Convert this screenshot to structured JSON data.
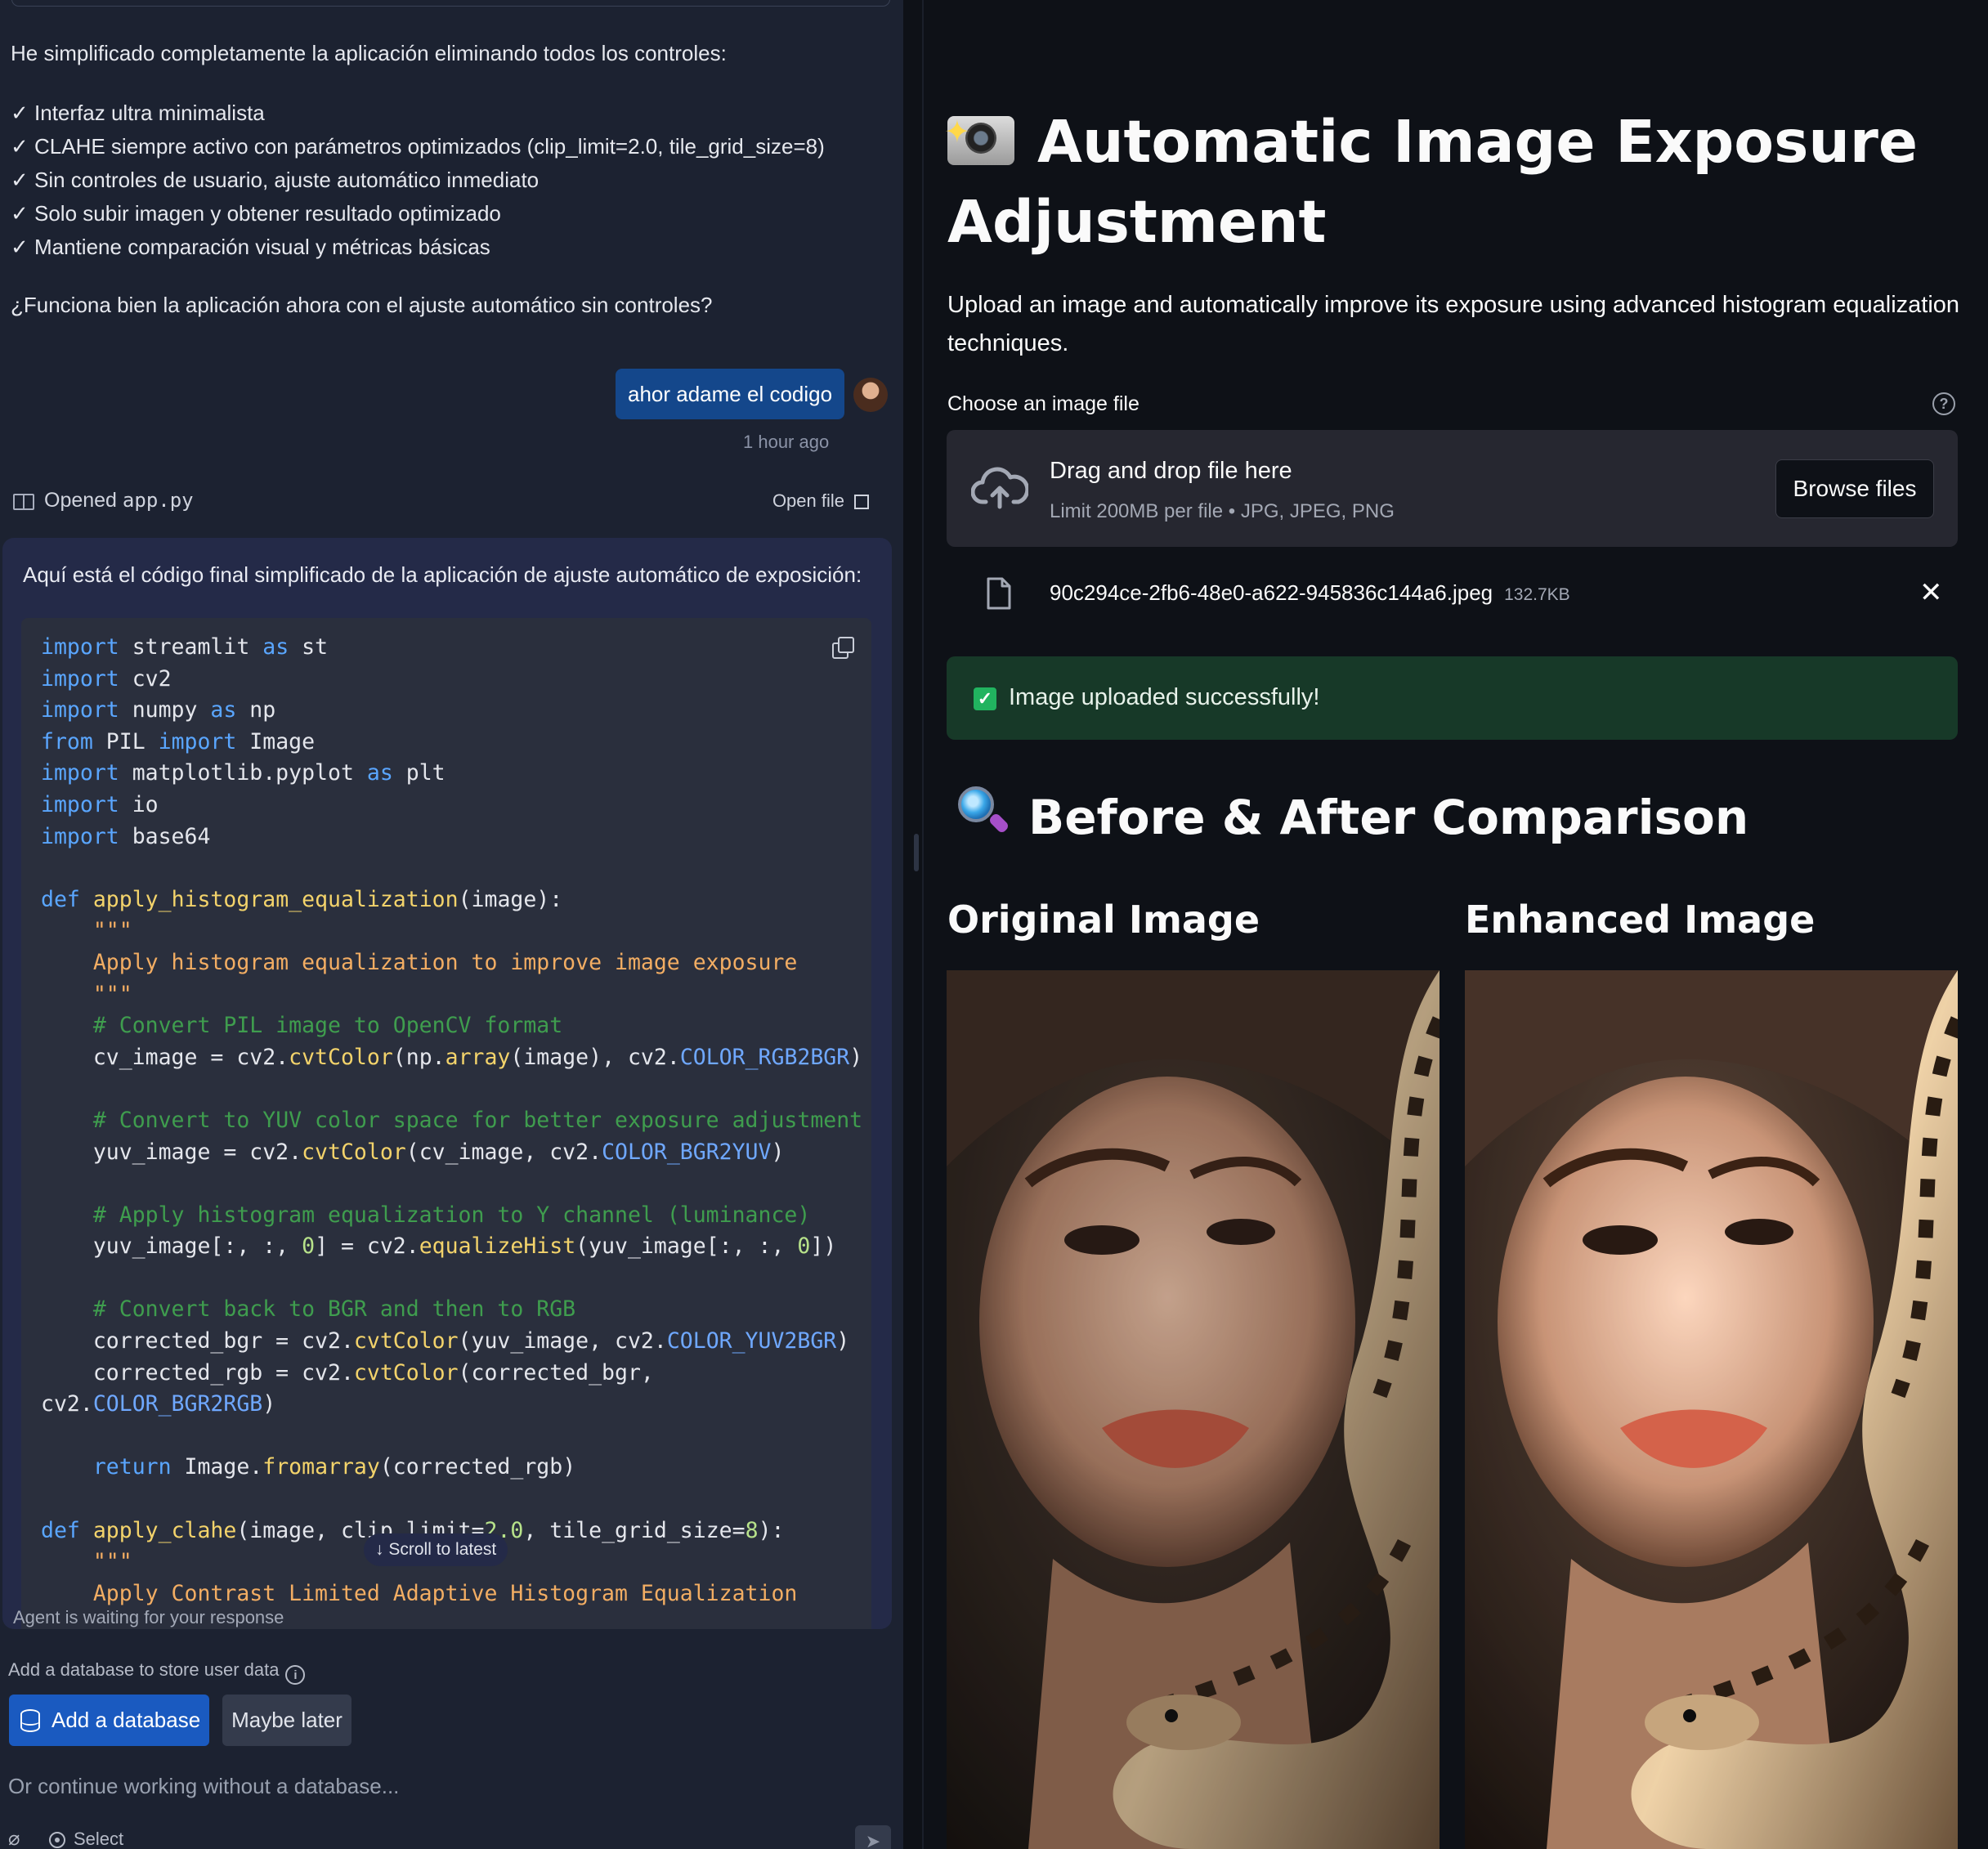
{
  "chat": {
    "intro": "He simplificado completamente la aplicación eliminando todos los controles:",
    "checklist": [
      "✓ Interfaz ultra minimalista",
      "✓ CLAHE siempre activo con parámetros optimizados (clip_limit=2.0, tile_grid_size=8)",
      "✓ Sin controles de usuario, ajuste automático inmediato",
      "✓ Solo subir imagen y obtener resultado optimizado",
      "✓ Mantiene comparación visual y métricas básicas"
    ],
    "question": "¿Funciona bien la aplicación ahora con el ajuste automático sin controles?",
    "user_message": "ahor adame el codigo",
    "timestamp": "1 hour ago",
    "opened_prefix": "Opened",
    "opened_file": "app.py",
    "open_file_label": "Open file",
    "code_intro": "Aquí está el código final simplificado de la aplicación de ajuste automático de exposición:",
    "scroll_latest": "Scroll to latest",
    "agent_status": "Agent is waiting for your response"
  },
  "database_prompt": {
    "text": "Add a database to store user data",
    "add_button": "Add a database",
    "later_button": "Maybe later",
    "input_placeholder": "Or continue working without a database...",
    "select_label": "Select"
  },
  "app": {
    "title": "Automatic Image Exposure Adjustment",
    "subtitle": "Upload an image and automatically improve its exposure using advanced histogram equalization techniques.",
    "uploader_label": "Choose an image file",
    "drag_text": "Drag and drop file here",
    "limit_text": "Limit 200MB per file • JPG, JPEG, PNG",
    "browse_button": "Browse files",
    "file_name": "90c294ce-2fb6-48e0-a622-945836c144a6.jpeg",
    "file_size": "132.7KB",
    "success_message": "Image uploaded successfully!",
    "comparison_heading": "Before & After Comparison",
    "original_heading": "Original Image",
    "enhanced_heading": "Enhanced Image"
  },
  "icons": {
    "help": "help-icon",
    "upload": "cloud-upload-icon",
    "file": "file-icon",
    "close": "close-icon",
    "success": "check-icon",
    "copy": "copy-icon",
    "database": "database-icon",
    "book": "book-icon",
    "external": "external-link-icon",
    "paperclip": "paperclip-icon",
    "send": "send-icon"
  },
  "colors": {
    "primary_button": "#1a5ac0",
    "user_bubble": "#14478b",
    "success_bg": "#173928",
    "app_bg": "#0e1117",
    "chat_bg": "#1c2231"
  }
}
